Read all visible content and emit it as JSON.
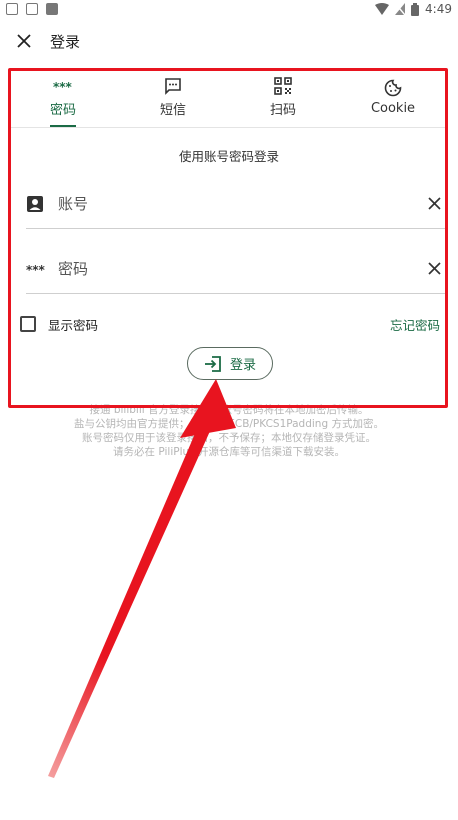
{
  "status_bar": {
    "time": "4:49"
  },
  "app_bar": {
    "title": "登录"
  },
  "tabs": [
    {
      "label": "密码",
      "icon": "password-dots-icon",
      "active": true
    },
    {
      "label": "短信",
      "icon": "sms-icon",
      "active": false
    },
    {
      "label": "扫码",
      "icon": "qr-code-icon",
      "active": false
    },
    {
      "label": "Cookie",
      "icon": "cookie-icon",
      "active": false
    }
  ],
  "form": {
    "subtitle": "使用账号密码登录",
    "account_placeholder": "账号",
    "password_placeholder": "密码",
    "show_password_label": "显示密码",
    "forgot_password_label": "忘记密码",
    "login_label": "登录"
  },
  "disclaimer": {
    "line1": "接通 bilibili 官方登录接口，账号密码将在本地加密后传输。",
    "line2": "盐与公钥均由官方提供；以 RSA/ECB/PKCS1Padding 方式加密。",
    "line3": "账号密码仅用于该登录接口，不予保存；本地仅存储登录凭证。",
    "line4": "请务必在 PiliPlus 开源仓库等可信渠道下载安装。"
  },
  "colors": {
    "accent": "#1b6b45",
    "annotation": "#e8141f"
  }
}
